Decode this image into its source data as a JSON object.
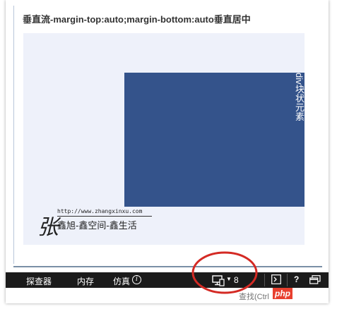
{
  "page": {
    "heading": "垂直流-margin-top:auto;margin-bottom:auto垂直居中"
  },
  "demo": {
    "block_label": "div块状元素",
    "block_color": "#34538b",
    "box_color": "#eef1fa"
  },
  "watermark": {
    "glyph": "张",
    "url": "http://www.zhangxinxu.com",
    "motto": "鑫旭-鑫空间-鑫生活"
  },
  "devtools": {
    "tabs": [
      {
        "label": "探查器"
      },
      {
        "label": "内存"
      },
      {
        "label": "仿真"
      }
    ],
    "info_icon": "i",
    "emulation_count": "8",
    "help_label": "?",
    "find_placeholder": "查找(Ctrl"
  },
  "overlay": {
    "badge_text": "php",
    "badge_color": "#e8402f",
    "ring_color": "#d42a24"
  }
}
